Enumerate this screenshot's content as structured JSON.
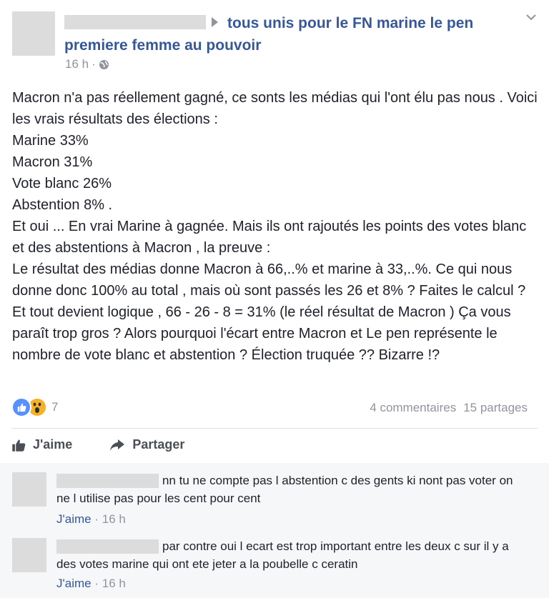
{
  "post": {
    "group_name": "tous unis pour le FN marine le pen premiere femme au pouvoir",
    "time": "16 h",
    "meta_sep": "·",
    "body_lines": [
      "Macron n'a pas réellement gagné, ce sonts les médias qui l'ont élu pas nous . Voici les vrais résultats des élections :",
      "Marine 33%",
      "Macron 31%",
      "Vote blanc 26%",
      "Abstention 8% .",
      "Et oui ... En vrai Marine à gagnée. Mais ils ont rajoutés les points des votes blanc et des abstentions à Macron , la preuve :",
      "Le résultat des médias donne Macron à 66,..% et marine à 33,..%. Ce qui nous donne donc 100% au total , mais où sont passés les 26 et 8% ? Faites le calcul ? Et tout devient logique , 66 - 26 - 8 = 31% (le réel résultat de Macron ) Ça vous paraît trop gros ? Alors pourquoi l'écart entre Macron et Le pen représente le nombre de vote blanc et abstention ? Élection truquée ?? Bizarre !?"
    ],
    "reaction_count": "7",
    "comments_count": "4 commentaires",
    "shares_count": "15 partages"
  },
  "actions": {
    "like_label": "J'aime",
    "share_label": "Partager"
  },
  "comments": [
    {
      "text": "nn tu ne compte pas l abstention c des gents ki nont pas voter on ne l utilise pas pour les cent pour cent",
      "like_label": "J'aime",
      "sep": "·",
      "time": "16 h"
    },
    {
      "text": "par contre oui l ecart est trop important entre les deux c sur il y a des votes marine qui ont ete jeter a la poubelle c ceratin",
      "like_label": "J'aime",
      "sep": "·",
      "time": "16 h"
    }
  ],
  "colors": {
    "link": "#365899",
    "muted": "#90949c",
    "like_reaction": "#5890ff",
    "wow_reaction": "#f7b125"
  },
  "icons": [
    "arrow-icon",
    "chevron-down-icon",
    "globe-icon",
    "like-reaction-icon",
    "wow-reaction-icon",
    "thumbs-up-icon",
    "share-arrow-icon"
  ]
}
